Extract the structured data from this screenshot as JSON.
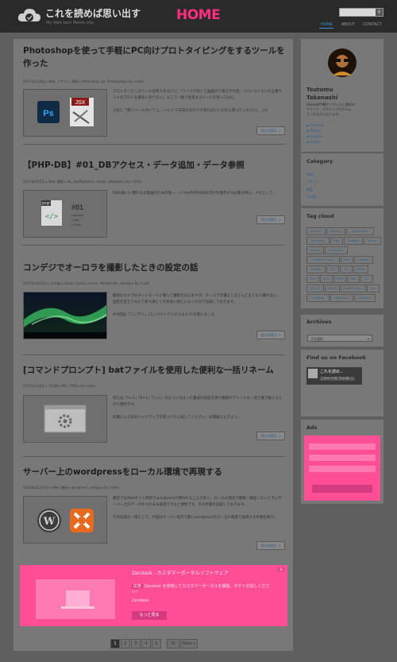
{
  "header": {
    "site_title": "これを読めば思い出す",
    "site_subtitle": "My Web tech Memo site",
    "home_label": "HOME",
    "search_icon": "search-icon",
    "nav": [
      "HOME",
      "ABOUT",
      "CONTACT"
    ]
  },
  "posts": [
    {
      "title": "Photoshopを使って手軽にPC向けプロトタイピングをするツールを作った",
      "meta": "2017年2月4日  ▸ Web, デザイン, 開発  ▸ Photoshop, jsx, Prototyping  ▸ By t-nishi",
      "excerpt": "プロトタイピングツールは色々あるけど、「リンクが多くて画面切り替えが大変」っていうくらいの企業サイトのプロトを素早く作りたい。そこで一発で生成するツールを作ってみた。",
      "excerpt2": "小出し「使いツール付いて上」（→という方向の分かりがあればいいかなと使ってください(_ _)m",
      "more": "続きを読む →",
      "thumb": "photoshop-jsx-icon"
    },
    {
      "title": "【PHP-DB】#01_DBアクセス・データ追加・データ参照",
      "meta": "2017年2月2日  ▸ Web, 開発  ▸ db, phpMyAdmin, server, database  ▸ By t-nishi",
      "excerpt": "DBの扱いに慣れるる勉強のための第一、いつもPHPのDBを何かを保存する必要な時に、メモとして。",
      "more": "続きを読む →",
      "thumb": "php-db-icon"
    },
    {
      "title": "コンデジでオーロラを撮影したときの設定の話",
      "meta": "2017年1月23日  ▸ その他  ▸ Canon, Aurora, canon, Yellowknife, canada  ▸ By t-nishi",
      "excerpt": "最初はカメラのオートモードに頼って撮影をはじめすが、オーロラを撮るとほとんどまともに撮れない。設定を変えてみたり色々試して大体良い感じになったので記録しておきます。",
      "excerpt2": "※今回は「コンデジ」(コンパクトデジタルカメラ)を使いました",
      "more": "続きを読む →",
      "thumb": "aurora-photo"
    },
    {
      "title": "[コマンドプロンプト] batファイルを使用した便利な一括リネーム",
      "meta": "2017年1月8日  ▸ その他  ▸ Win, CMD  ▸ By t-nishi",
      "excerpt": "例えば「A+1」「B+1」「C+1」のように決まった書式の名前を持つ複数のファイルを一括で書き換えるときに便利です。",
      "excerpt2": "作業に入る前のバックアップを取ってから試してください。お間違えなきよう。",
      "more": "続きを読む →",
      "thumb": "gear-window-icon"
    },
    {
      "title": "サーバー上のwordpressをローカル環境で再現する",
      "meta": "2016年12月29日  ▸ Web, 開発  ▸ wordpress, xampp  ▸ By t-nishi",
      "excerpt": "最近ではWebサイト制作でwordpressが使われることが多く、ローカル環境で開発・検証したいときにサーバー上のデータをそのまま再現できると便利です。その手順を記録しておきます。",
      "excerpt2": "その前提の一環として、今回はサーバー先行で動くwordpressをローカル環境で再現する手順を紹介。",
      "more": "続きを読む →",
      "thumb": "wordpress-xampp-icons"
    }
  ],
  "ad_bottom": {
    "title": "Zendesk - カスタマーポータルソフトウェア",
    "badge": "広告",
    "body": "Zendesk を使用してカスタマーポータルを構築、今すぐお試しください！",
    "sub": "Zendesk",
    "cta": "もっと見る"
  },
  "pagination": [
    "1",
    "2",
    "3",
    "4",
    "5",
    "...",
    "15",
    "Next »"
  ],
  "sidebar": {
    "profile_name": "Tsutomu Takanashi",
    "profile_text": [
      "Web系専門職サーヴィスと運用の",
      "デザイナ、デザインプログラム、",
      "どっちもがんばります。"
    ],
    "social": [
      "Facebook",
      "Twitter",
      "Google+",
      "GitHub"
    ],
    "category_title": "Category",
    "categories": [
      "Web",
      "デザイン",
      "開発",
      "その他"
    ],
    "tagcloud_title": "Tag cloud",
    "tags": [
      "ada-nim",
      "android",
      "Application",
      "App Store",
      "blog",
      "browser",
      "canvas",
      "chrome",
      "cocos2d-x",
      "Creative Cloud",
      "dmm",
      "eclipse",
      "Eclipse",
      "FTP",
      "git",
      "Redmi",
      "Slim",
      "Gulp",
      "MAMP",
      "Mac",
      "js",
      "jQuery",
      "MySQL",
      "phpMyAdmin",
      "php",
      "scripting",
      "wordpress",
      "software",
      "tool",
      "xampp",
      "web-dev"
    ],
    "archives_title": "Archives",
    "archives_select": "月を選択",
    "facebook_title": "Find us on Facebook",
    "facebook_page": "これを読め...",
    "facebook_like": "このページを「いいね！」",
    "ads_title": "Ads"
  }
}
